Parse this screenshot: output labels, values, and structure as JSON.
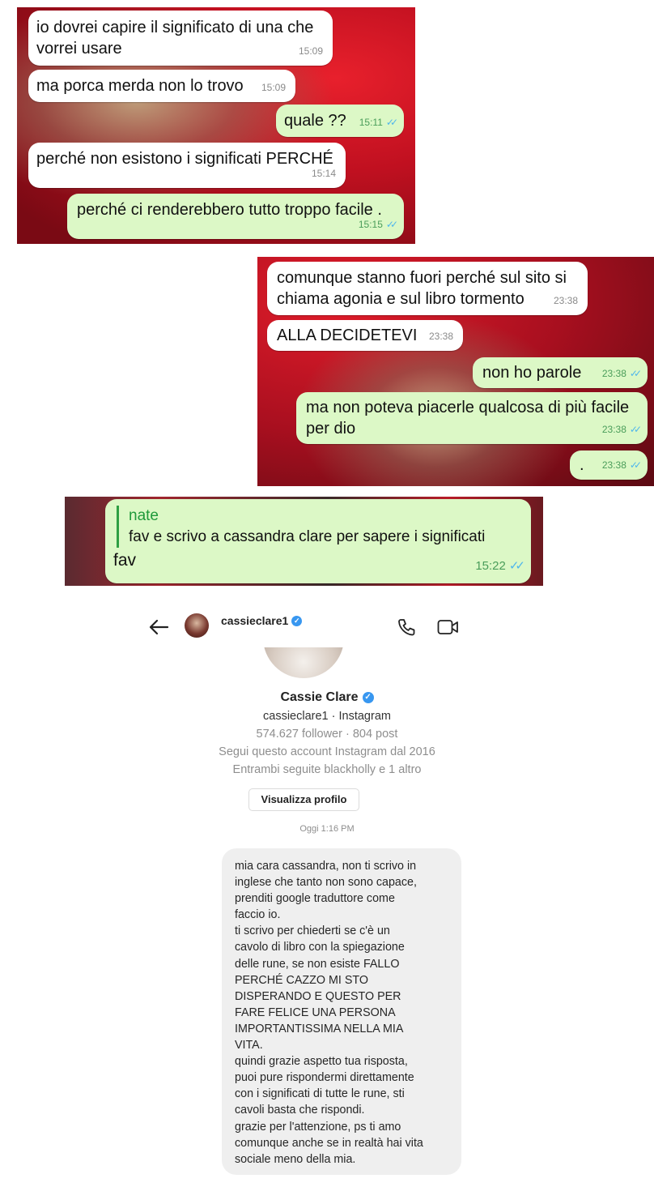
{
  "chat1": {
    "messages": [
      {
        "type": "in",
        "text": "io dovrei capire il significato di una che\nvorrei usare",
        "time": "15:09"
      },
      {
        "type": "in",
        "text": "ma porca merda non lo trovo",
        "time": "15:09"
      },
      {
        "type": "out",
        "text": "quale ??",
        "time": "15:11"
      },
      {
        "type": "in",
        "text": "perché non esistono i significati PERCHÉ",
        "time": "15:14"
      },
      {
        "type": "out",
        "text": "perché ci renderebbero tutto troppo facile .",
        "time": "15:15"
      }
    ]
  },
  "chat2": {
    "messages": [
      {
        "type": "in",
        "text": "comunque stanno fuori perché sul sito si\nchiama agonia e sul libro tormento",
        "time": "23:38"
      },
      {
        "type": "in",
        "text": "ALLA DECIDETEVI",
        "time": "23:38"
      },
      {
        "type": "out",
        "text": "non ho parole",
        "time": "23:38"
      },
      {
        "type": "out",
        "text": "ma non poteva piacerle qualcosa di più facile\nper dio",
        "time": "23:38"
      },
      {
        "type": "out",
        "text": ".",
        "time": "23:38"
      }
    ]
  },
  "chat3": {
    "quote_author": "nate",
    "quote_text": "fav e scrivo a cassandra clare per sapere i significati",
    "text": "fav",
    "time": "15:22"
  },
  "instagram": {
    "header_username": "cassieclare1",
    "profile_name": "Cassie Clare",
    "handle_line": "cassieclare1 · Instagram",
    "stats_line": "574.627 follower · 804 post",
    "follow_since": "Segui questo account Instagram dal 2016",
    "mutual": "Entrambi seguite blackholly e 1 altro",
    "view_profile_label": "Visualizza profilo",
    "timestamp": "Oggi 1:16 PM",
    "message": "mia cara cassandra, non ti scrivo in\ninglese che tanto non sono capace,\nprenditi google traduttore come\nfaccio io.\nti scrivo per chiederti se c'è un\ncavolo di libro con la spiegazione\ndelle rune, se non esiste FALLO\nPERCHÉ CAZZO MI STO\nDISPERANDO E QUESTO PER\nFARE FELICE UNA PERSONA\nIMPORTANTISSIMA NELLA MIA\nVITA.\nquindi grazie aspetto tua risposta,\npuoi pure rispondermi direttamente\ncon i significati di tutte le rune, sti\ncavoli basta che rispondi.\ngrazie per l'attenzione, ps ti amo\ncomunque anche se in realtà hai vita\nsociale meno della mia.",
    "icons": [
      "back-arrow-icon",
      "phone-icon",
      "video-icon",
      "verified-badge-icon"
    ],
    "verified_color": "#3897f0"
  }
}
